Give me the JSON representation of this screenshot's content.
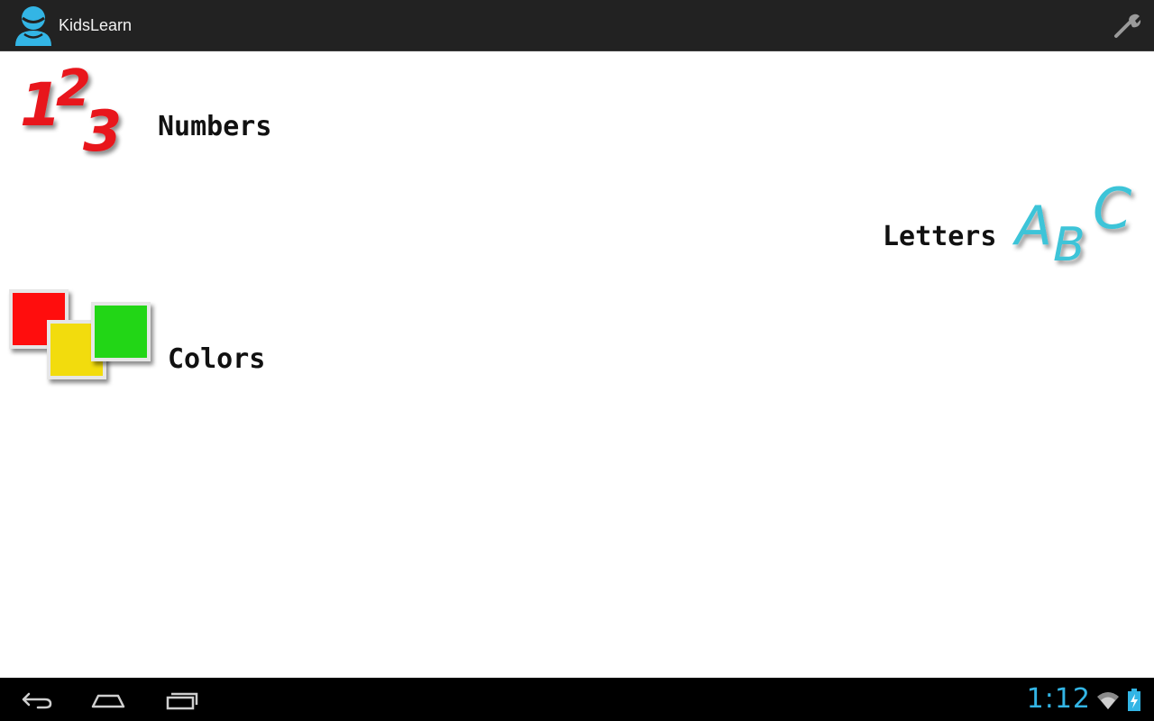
{
  "action_bar": {
    "title": "KidsLearn",
    "app_icon": "kid-avatar-icon",
    "settings_icon": "wrench-icon"
  },
  "menu": {
    "numbers": {
      "label": "Numbers",
      "icon": "numbers-123-icon",
      "glyphs": [
        "1",
        "2",
        "3"
      ]
    },
    "letters": {
      "label": "Letters",
      "icon": "letters-abc-icon",
      "glyphs": [
        "A",
        "B",
        "C"
      ]
    },
    "colors": {
      "label": "Colors",
      "icon": "color-squares-icon"
    }
  },
  "nav_bar": {
    "back_icon": "back-icon",
    "home_icon": "home-icon",
    "recents_icon": "recents-icon"
  },
  "status": {
    "time": "1:12",
    "wifi_icon": "wifi-icon",
    "battery_icon": "battery-charging-icon"
  },
  "colors": {
    "action_bar_bg": "#222222",
    "accent": "#33b5e5",
    "numbers_red": "#e8141b",
    "letters_cyan": "#3cc4d8",
    "square_red": "#ff0f0f",
    "square_yellow": "#f2dc0a",
    "square_green": "#22d614"
  }
}
